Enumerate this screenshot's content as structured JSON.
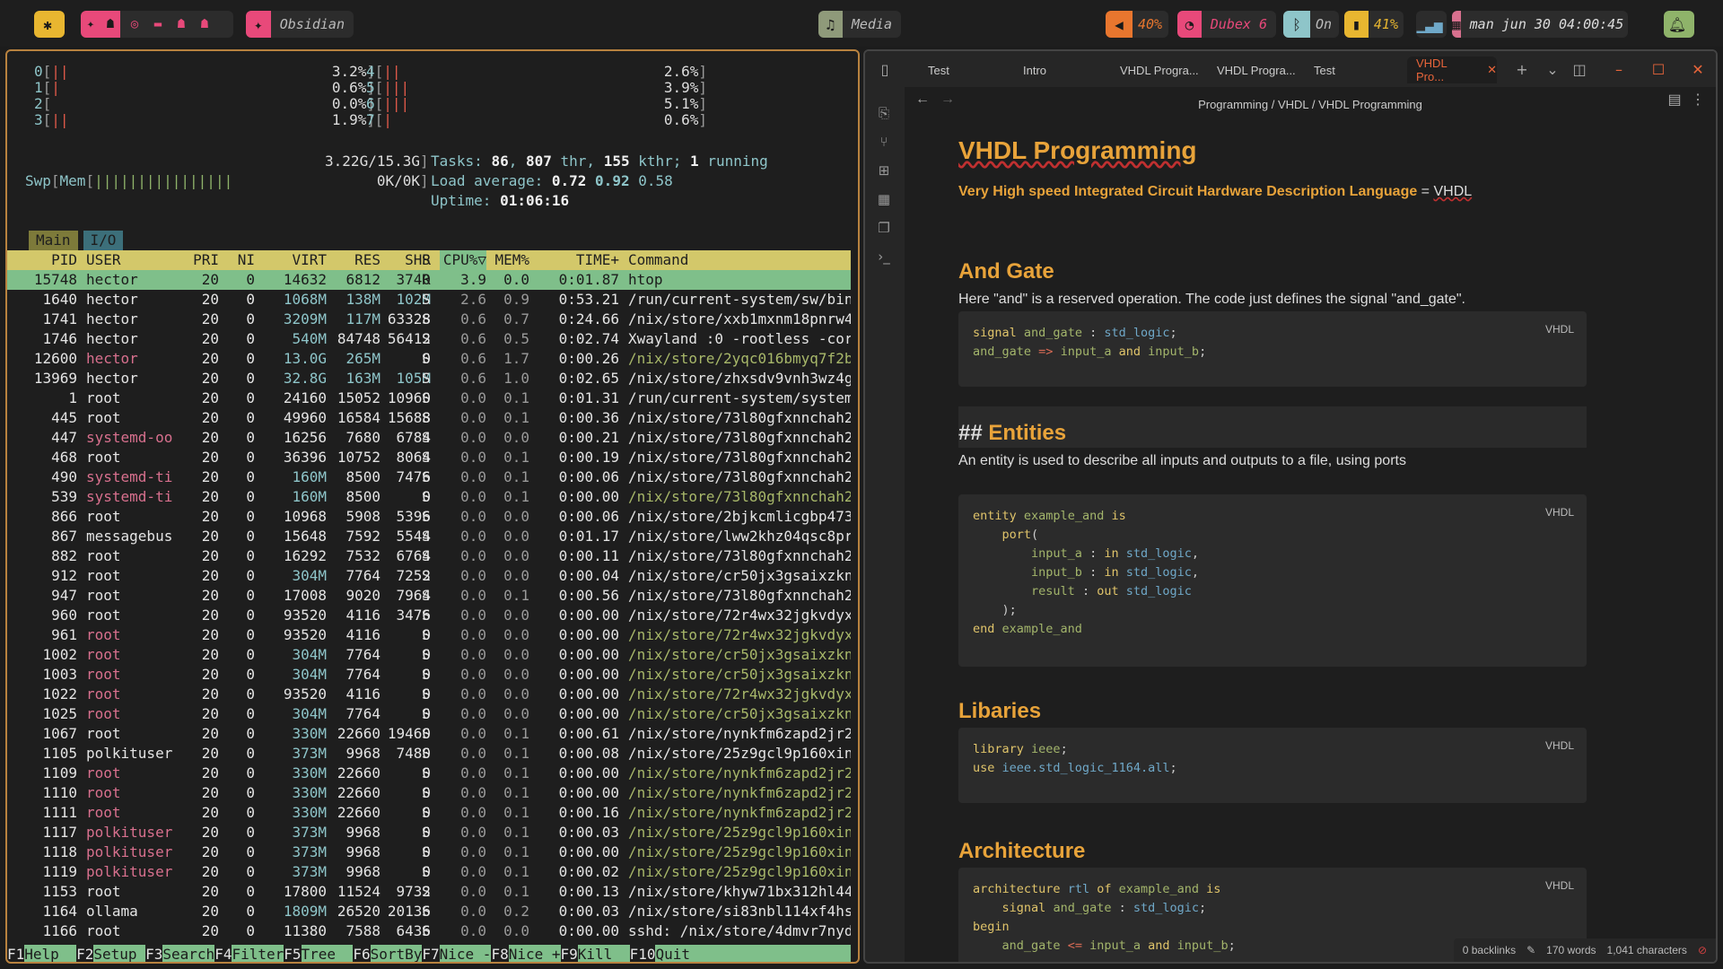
{
  "topbar": {
    "left_icons": [
      "gear-icon",
      "fox-icon",
      "ghost-icon",
      "target-icon",
      "folder-icon",
      "ghost2-icon",
      "ghost3-icon"
    ],
    "workspace_app": "Obsidian",
    "media_label": "Media",
    "volume": "40%",
    "wifi": "Dubex 6",
    "bluetooth": "On",
    "battery": "41%",
    "datetime": "man jun 30  04:00:45"
  },
  "htop": {
    "cpus": [
      {
        "id": "0",
        "pct": "3.2%"
      },
      {
        "id": "1",
        "pct": "0.6%"
      },
      {
        "id": "2",
        "pct": "0.0%"
      },
      {
        "id": "3",
        "pct": "1.9%"
      },
      {
        "id": "4",
        "pct": "2.6%"
      },
      {
        "id": "5",
        "pct": "3.9%"
      },
      {
        "id": "6",
        "pct": "5.1%"
      },
      {
        "id": "7",
        "pct": "0.6%"
      }
    ],
    "mem_label": "Mem",
    "mem_value": "3.22G/15.3G",
    "swp_label": "Swp",
    "swp_value": "0K/0K",
    "tasks_label": "Tasks:",
    "tasks": "86",
    "thr": "807",
    "thr_label": "thr,",
    "kthr": "155",
    "kthr_label": "kthr;",
    "running": "1",
    "running_label": "running",
    "load_label": "Load average:",
    "load1": "0.72",
    "load5": "0.92",
    "load15": "0.58",
    "uptime_label": "Uptime:",
    "uptime": "01:06:16",
    "tabs": [
      "Main",
      "I/O"
    ],
    "columns": [
      "PID",
      "USER",
      "PRI",
      "NI",
      "VIRT",
      "RES",
      "SHR",
      "S",
      "CPU%▽",
      "MEM%",
      "TIME+",
      "Command"
    ],
    "processes": [
      [
        "15748",
        "hector",
        "20",
        "0",
        "14632",
        "6812",
        "3740",
        "R",
        "3.9",
        "0.0",
        "0:01.87",
        "htop"
      ],
      [
        "1640",
        "hector",
        "20",
        "0",
        "1068M",
        "138M",
        "102M",
        "S",
        "2.6",
        "0.9",
        "0:53.21",
        "/run/current-system/sw/bin/"
      ],
      [
        "1741",
        "hector",
        "20",
        "0",
        "3209M",
        "117M",
        "63328",
        "S",
        "0.6",
        "0.7",
        "0:24.66",
        "/nix/store/xxb1mxnm18pnrw4y"
      ],
      [
        "1746",
        "hector",
        "20",
        "0",
        "540M",
        "84748",
        "56412",
        "S",
        "0.6",
        "0.5",
        "0:02.74",
        "Xwayland :0 -rootless -core"
      ],
      [
        "12600",
        "hector",
        "20",
        "0",
        "13.0G",
        "265M",
        "0",
        "S",
        "0.6",
        "1.7",
        "0:00.26",
        "/nix/store/2yqc016bmyq7f2bw"
      ],
      [
        "13969",
        "hector",
        "20",
        "0",
        "32.8G",
        "163M",
        "105M",
        "S",
        "0.6",
        "1.0",
        "0:02.65",
        "/nix/store/zhxsdv9vnh3wz4gc"
      ],
      [
        "1",
        "root",
        "20",
        "0",
        "24160",
        "15052",
        "10960",
        "S",
        "0.0",
        "0.1",
        "0:01.31",
        "/run/current-system/systemd"
      ],
      [
        "445",
        "root",
        "20",
        "0",
        "49960",
        "16584",
        "15688",
        "S",
        "0.0",
        "0.1",
        "0:00.36",
        "/nix/store/73l80gfxnnchah2d"
      ],
      [
        "447",
        "systemd-oo",
        "20",
        "0",
        "16256",
        "7680",
        "6784",
        "S",
        "0.0",
        "0.0",
        "0:00.21",
        "/nix/store/73l80gfxnnchah2d"
      ],
      [
        "468",
        "root",
        "20",
        "0",
        "36396",
        "10752",
        "8064",
        "S",
        "0.0",
        "0.1",
        "0:00.19",
        "/nix/store/73l80gfxnnchah2d"
      ],
      [
        "490",
        "systemd-ti",
        "20",
        "0",
        "160M",
        "8500",
        "7476",
        "S",
        "0.0",
        "0.1",
        "0:00.06",
        "/nix/store/73l80gfxnnchah2d"
      ],
      [
        "539",
        "systemd-ti",
        "20",
        "0",
        "160M",
        "8500",
        "0",
        "S",
        "0.0",
        "0.1",
        "0:00.00",
        "/nix/store/73l80gfxnnchah2d"
      ],
      [
        "866",
        "root",
        "20",
        "0",
        "10968",
        "5908",
        "5396",
        "S",
        "0.0",
        "0.0",
        "0:00.06",
        "/nix/store/2bjkcmlicgbp4732"
      ],
      [
        "867",
        "messagebus",
        "20",
        "0",
        "15648",
        "7592",
        "5544",
        "S",
        "0.0",
        "0.0",
        "0:01.17",
        "/nix/store/lww2khz04qsc8prj"
      ],
      [
        "882",
        "root",
        "20",
        "0",
        "16292",
        "7532",
        "6764",
        "S",
        "0.0",
        "0.0",
        "0:00.11",
        "/nix/store/73l80gfxnnchah2d"
      ],
      [
        "912",
        "root",
        "20",
        "0",
        "304M",
        "7764",
        "7252",
        "S",
        "0.0",
        "0.0",
        "0:00.04",
        "/nix/store/cr50jx3gsaixzkn8"
      ],
      [
        "947",
        "root",
        "20",
        "0",
        "17008",
        "9020",
        "7964",
        "S",
        "0.0",
        "0.1",
        "0:00.56",
        "/nix/store/73l80gfxnnchah2d"
      ],
      [
        "960",
        "root",
        "20",
        "0",
        "93520",
        "4116",
        "3476",
        "S",
        "0.0",
        "0.0",
        "0:00.00",
        "/nix/store/72r4wx32jgkvdyx6"
      ],
      [
        "961",
        "root",
        "20",
        "0",
        "93520",
        "4116",
        "0",
        "S",
        "0.0",
        "0.0",
        "0:00.00",
        "/nix/store/72r4wx32jgkvdyx6"
      ],
      [
        "1002",
        "root",
        "20",
        "0",
        "304M",
        "7764",
        "0",
        "S",
        "0.0",
        "0.0",
        "0:00.00",
        "/nix/store/cr50jx3gsaixzkn8"
      ],
      [
        "1003",
        "root",
        "20",
        "0",
        "304M",
        "7764",
        "0",
        "S",
        "0.0",
        "0.0",
        "0:00.00",
        "/nix/store/cr50jx3gsaixzkn8"
      ],
      [
        "1022",
        "root",
        "20",
        "0",
        "93520",
        "4116",
        "0",
        "S",
        "0.0",
        "0.0",
        "0:00.00",
        "/nix/store/72r4wx32jgkvdyx6"
      ],
      [
        "1025",
        "root",
        "20",
        "0",
        "304M",
        "7764",
        "0",
        "S",
        "0.0",
        "0.0",
        "0:00.00",
        "/nix/store/cr50jx3gsaixzkn8"
      ],
      [
        "1067",
        "root",
        "20",
        "0",
        "330M",
        "22660",
        "19460",
        "S",
        "0.0",
        "0.1",
        "0:00.61",
        "/nix/store/nynkfm6zapd2jr2p"
      ],
      [
        "1105",
        "polkituser",
        "20",
        "0",
        "373M",
        "9968",
        "7480",
        "S",
        "0.0",
        "0.1",
        "0:00.08",
        "/nix/store/25z9gcl9p160xinw"
      ],
      [
        "1109",
        "root",
        "20",
        "0",
        "330M",
        "22660",
        "0",
        "S",
        "0.0",
        "0.1",
        "0:00.00",
        "/nix/store/nynkfm6zapd2jr2p"
      ],
      [
        "1110",
        "root",
        "20",
        "0",
        "330M",
        "22660",
        "0",
        "S",
        "0.0",
        "0.1",
        "0:00.00",
        "/nix/store/nynkfm6zapd2jr2p"
      ],
      [
        "1111",
        "root",
        "20",
        "0",
        "330M",
        "22660",
        "0",
        "S",
        "0.0",
        "0.1",
        "0:00.16",
        "/nix/store/nynkfm6zapd2jr2p"
      ],
      [
        "1117",
        "polkituser",
        "20",
        "0",
        "373M",
        "9968",
        "0",
        "S",
        "0.0",
        "0.1",
        "0:00.03",
        "/nix/store/25z9gcl9p160xinw"
      ],
      [
        "1118",
        "polkituser",
        "20",
        "0",
        "373M",
        "9968",
        "0",
        "S",
        "0.0",
        "0.1",
        "0:00.00",
        "/nix/store/25z9gcl9p160xinw"
      ],
      [
        "1119",
        "polkituser",
        "20",
        "0",
        "373M",
        "9968",
        "0",
        "S",
        "0.0",
        "0.1",
        "0:00.02",
        "/nix/store/25z9gcl9p160xinw"
      ],
      [
        "1153",
        "root",
        "20",
        "0",
        "17800",
        "11524",
        "9732",
        "S",
        "0.0",
        "0.1",
        "0:00.13",
        "/nix/store/khyw71bx312hl44h"
      ],
      [
        "1164",
        "ollama",
        "20",
        "0",
        "1809M",
        "26520",
        "20136",
        "S",
        "0.0",
        "0.2",
        "0:00.03",
        "/nix/store/si83nbl114xf4hsf"
      ],
      [
        "1166",
        "root",
        "20",
        "0",
        "11380",
        "7588",
        "6436",
        "S",
        "0.0",
        "0.0",
        "0:00.00",
        "sshd: /nix/store/4dmvr7nydy"
      ]
    ],
    "footer": [
      {
        "key": "F1",
        "label": "Help  "
      },
      {
        "key": "F2",
        "label": "Setup "
      },
      {
        "key": "F3",
        "label": "Search"
      },
      {
        "key": "F4",
        "label": "Filter"
      },
      {
        "key": "F5",
        "label": "Tree  "
      },
      {
        "key": "F6",
        "label": "SortBy"
      },
      {
        "key": "F7",
        "label": "Nice -"
      },
      {
        "key": "F8",
        "label": "Nice +"
      },
      {
        "key": "F9",
        "label": "Kill  "
      },
      {
        "key": "F10",
        "label": "Quit"
      }
    ]
  },
  "obsidian": {
    "tabs": [
      "Test",
      "Intro",
      "VHDL Progra...",
      "VHDL Progra...",
      "Test",
      "VHDL Pro..."
    ],
    "breadcrumb": [
      "Programming",
      "/",
      "VHDL",
      "/",
      "VHDL Programming"
    ],
    "title": "VHDL Programming",
    "subtitle_bold": "Very High speed Integrated Circuit Hardware Description Language",
    "subtitle_eq": " = ",
    "subtitle_acronym": "VHDL",
    "sections": {
      "and_gate": "And Gate",
      "and_gate_text": "Here \"and\" is a reserved operation. The code just defines the signal \"and_gate\".",
      "entities_hash": "## ",
      "entities": "Entities",
      "entities_text": "An entity is used to describe all inputs and outputs to a file, using ports",
      "libaries": "Libaries",
      "architecture": "Architecture"
    },
    "code_lang": "VHDL",
    "status": {
      "backlinks": "0 backlinks",
      "words": "170 words",
      "chars": "1,041 characters"
    }
  }
}
